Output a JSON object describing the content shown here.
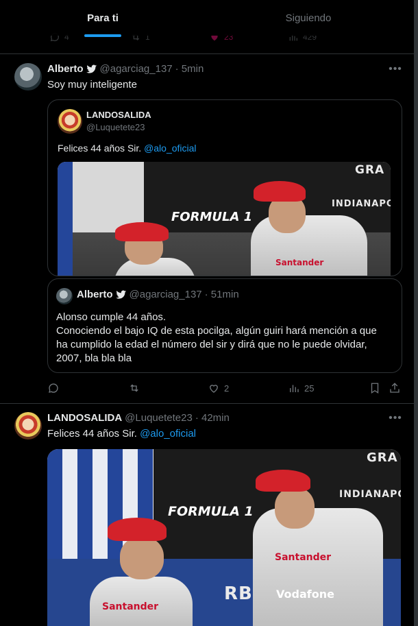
{
  "tabs": [
    {
      "label": "Para ti",
      "active": true
    },
    {
      "label": "Siguiendo",
      "active": false
    }
  ],
  "previous_tweet_actions": {
    "reply": "4",
    "retweet": "1",
    "like": "23",
    "views": "429"
  },
  "tweet1": {
    "author_name": "Alberto",
    "handle": "@agarciag_137",
    "time": "· 5min",
    "text": "Soy muy inteligente",
    "quoted": {
      "author_name": "LANDOSALIDA",
      "handle": "@Luquetete23",
      "text_prefix": "Felices 44 años Sir. ",
      "mention": "@alo_oficial",
      "nested_quote": {
        "author_name": "Alberto",
        "handle": "@agarciag_137",
        "time": "· 51min",
        "line1": "Alonso cumple 44 años.",
        "line2": "Conociendo el bajo IQ de esta pocilga, algún guiri hará mención a que ha cumplido la edad el número del sir y dirá que no le puede olvidar, 2007, bla bla bla"
      }
    },
    "actions": {
      "reply": "",
      "retweet": "",
      "like": "2",
      "views": "25"
    }
  },
  "tweet2": {
    "author_name": "LANDOSALIDA",
    "handle": "@Luquetete23",
    "time": "· 42min",
    "text_prefix": "Felices 44 años Sir. ",
    "mention": "@alo_oficial"
  },
  "photo_text": {
    "f1": "FORMULA 1",
    "sign1": "GRA",
    "sign2": "INDIANAPO",
    "sign2_full": "INDIANAPOLI",
    "sponsor": "Santander",
    "sponsor2": "Vodafone",
    "rb": "RB"
  },
  "colors": {
    "accent": "#1d9bf0",
    "like": "#f91880",
    "bg": "#000000",
    "muted": "#71767b"
  }
}
